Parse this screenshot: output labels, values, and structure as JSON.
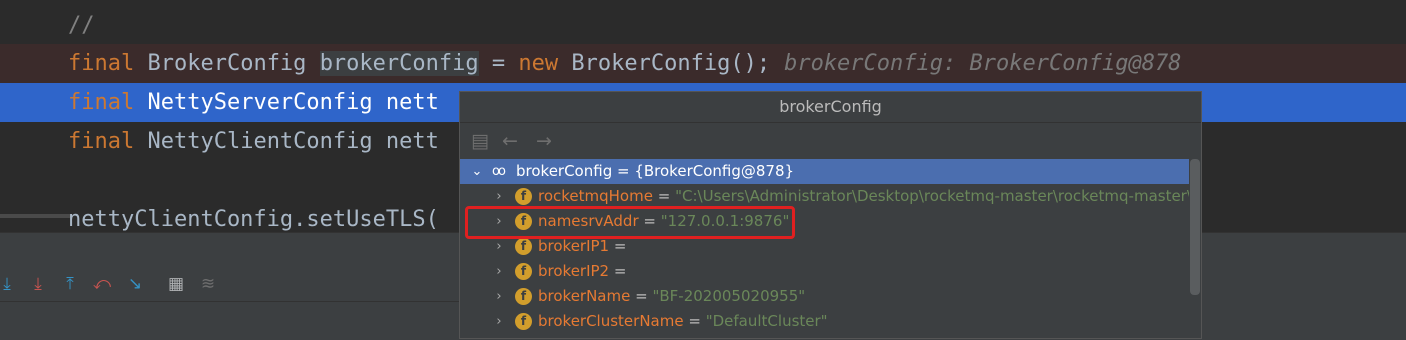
{
  "editor": {
    "line_comment": "//",
    "line_bp": {
      "kw_final": "final",
      "type": "BrokerConfig",
      "var": "brokerConfig",
      "eq": "=",
      "kw_new": "new",
      "ctor": "BrokerConfig();",
      "inline_value": "brokerConfig: BrokerConfig@878"
    },
    "line_sel": {
      "kw_final": "final",
      "text": "NettyServerConfig nett"
    },
    "line_3": {
      "kw_final": "final",
      "text": "NettyClientConfig nett"
    },
    "line_5": {
      "text": "nettyClientConfig.setUseTLS("
    }
  },
  "toolbar": {
    "icons": [
      "step-into-icon",
      "force-step-into-icon",
      "step-out-icon",
      "drop-frame-icon",
      "run-to-cursor-icon",
      "evaluate-expression-icon",
      "trace-icon"
    ],
    "colors": {
      "blue": "#3592c4",
      "red": "#c75450"
    }
  },
  "popup": {
    "title": "brokerConfig",
    "root": {
      "name": "brokerConfig",
      "value": "= {BrokerConfig@878}"
    },
    "fields": [
      {
        "name": "rocketmqHome",
        "value": "\"C:\\Users\\Administrator\\Desktop\\rocketmq-master\\rocketmq-master\\RC"
      },
      {
        "name": "namesrvAddr",
        "value": "\"127.0.0.1:9876\""
      },
      {
        "name": "brokerIP1",
        "value": ""
      },
      {
        "name": "brokerIP2",
        "value": ""
      },
      {
        "name": "brokerName",
        "value": "\"BF-202005020955\""
      },
      {
        "name": "brokerClusterName",
        "value": "\"DefaultCluster\""
      }
    ]
  },
  "colors": {
    "editor_bg": "#2b2b2b",
    "selection": "#2f65ca",
    "breakpoint_line": "#3b2b2b",
    "keyword": "#cc7832",
    "field_name": "#e67a33",
    "string": "#6a8759",
    "highlight_box": "#e02020"
  }
}
